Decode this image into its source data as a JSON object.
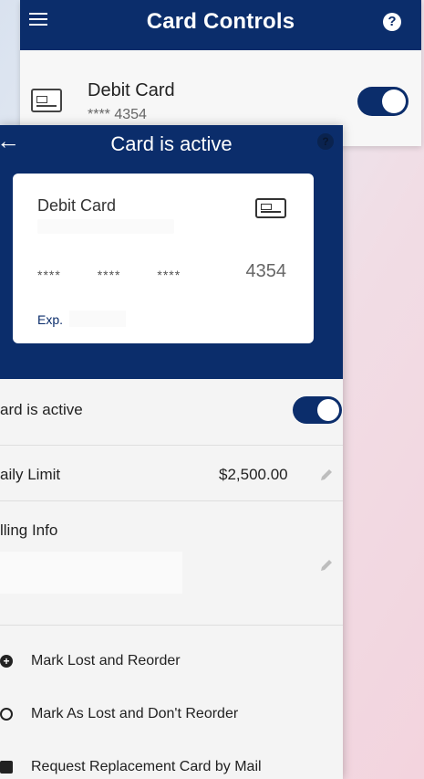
{
  "back_screen": {
    "title": "Card Controls",
    "help_glyph": "?",
    "card_label": "Debit Card",
    "card_number": "**** 4354",
    "toggle_state": "on"
  },
  "front_screen": {
    "title": "Card is active",
    "back_glyph": "←",
    "help_glyph": "?",
    "card": {
      "label": "Debit Card",
      "mask_1": "****",
      "mask_2": "****",
      "mask_3": "****",
      "last4": "4354",
      "exp_label": "Exp."
    },
    "rows": {
      "card_active_label": "ard is active",
      "card_active_toggle": "on",
      "daily_limit_label": "aily Limit",
      "daily_limit_value": "$2,500.00",
      "billing_label": "lling Info"
    },
    "actions": {
      "mark_lost_reorder": "Mark Lost and Reorder",
      "mark_lost_no_reorder": "Mark As Lost and Don't Reorder",
      "request_replacement": "Request Replacement Card by Mail"
    }
  },
  "colors": {
    "brand_navy": "#0b2d6b",
    "surface": "#f4f4f4",
    "card": "#ffffff"
  },
  "icons": [
    "menu-icon",
    "help-icon",
    "card-icon",
    "back-arrow-icon",
    "pencil-icon",
    "plus-circle-icon",
    "no-entry-icon",
    "mail-icon"
  ]
}
